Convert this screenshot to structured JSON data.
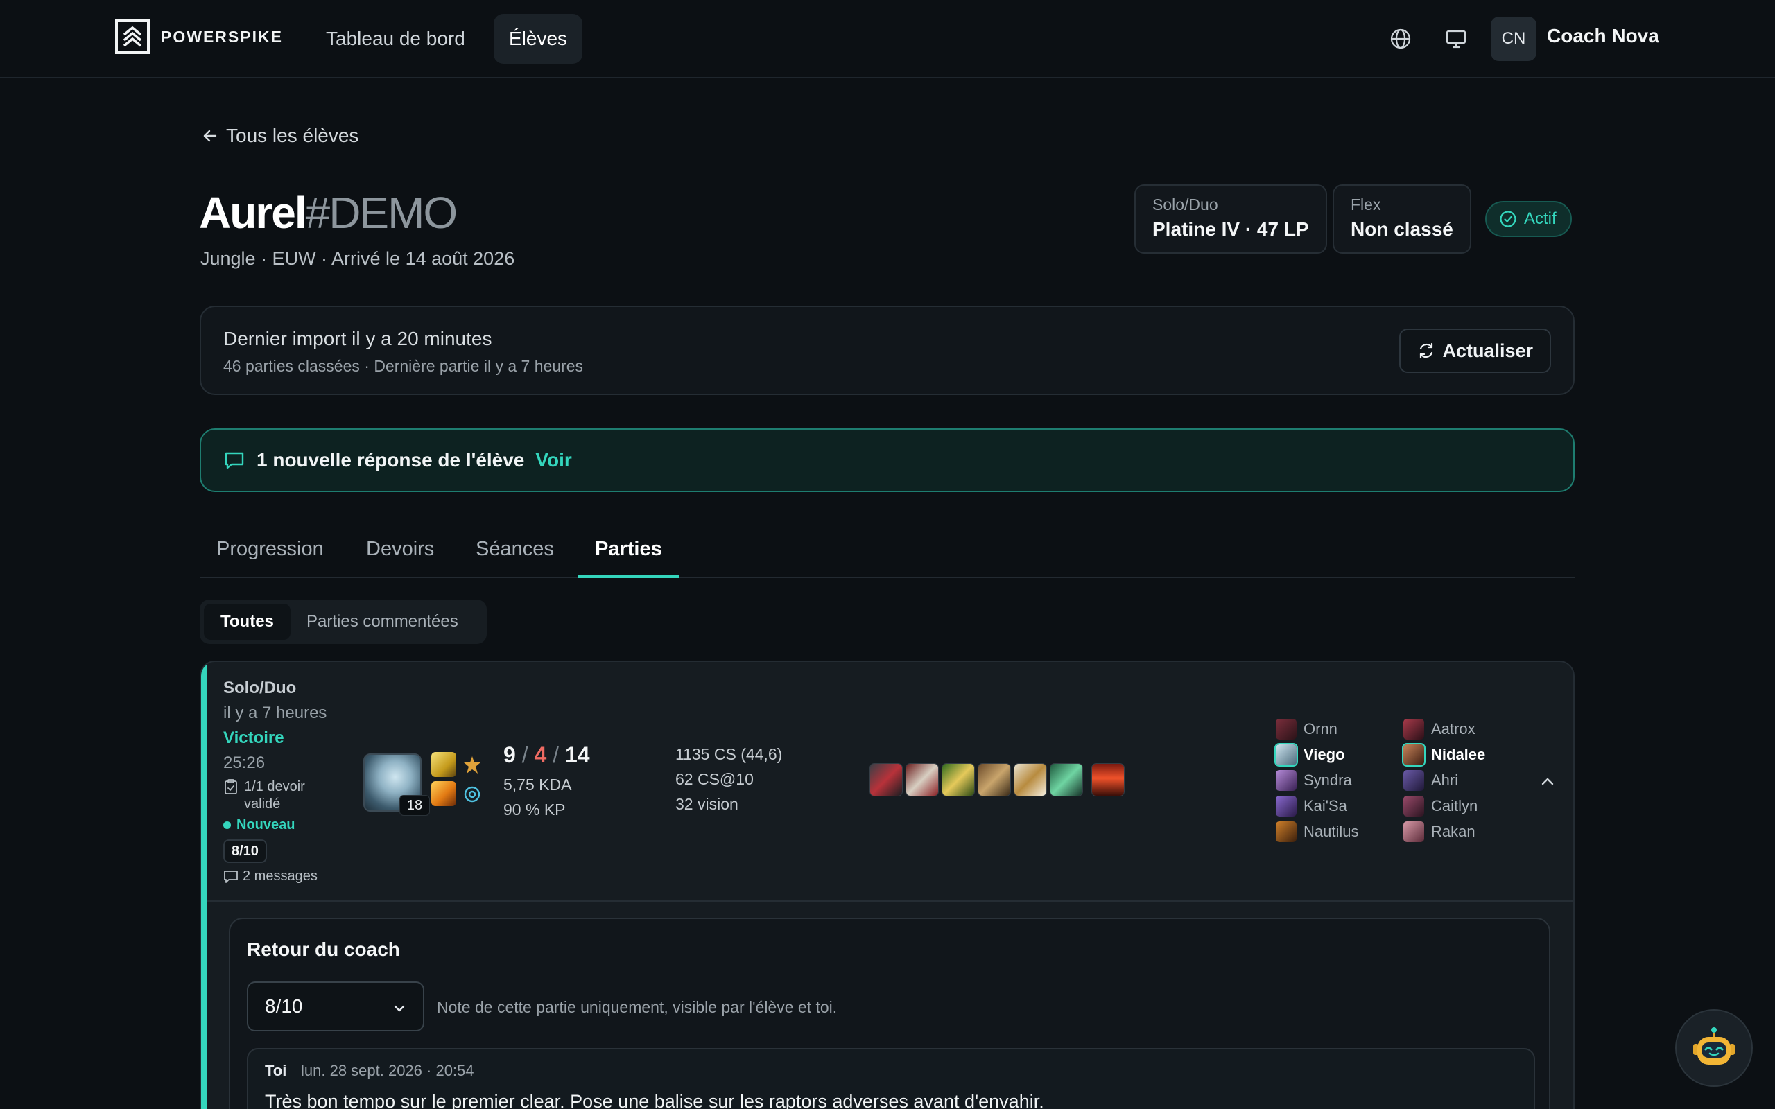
{
  "nav": {
    "brand": "POWERSPIKE",
    "links": [
      "Tableau de bord",
      "Élèves"
    ],
    "avatar_initials": "CN",
    "user_name": "Coach Nova"
  },
  "header": {
    "back_label": "Tous les élèves",
    "player_name": "Aurel",
    "player_tag": "#DEMO",
    "meta": "Jungle · EUW · Arrivé le 14 août 2026",
    "ranks": [
      {
        "queue": "Solo/Duo",
        "rank": "Platine IV · 47 LP"
      },
      {
        "queue": "Flex",
        "rank": "Non classé"
      }
    ],
    "status": "Actif"
  },
  "import": {
    "title": "Dernier import il y a 20 minutes",
    "subtitle": "46 parties classées · Dernière partie il y a 7 heures",
    "refresh_label": "Actualiser"
  },
  "notice": {
    "message": "1 nouvelle réponse de l'élève",
    "link": "Voir"
  },
  "tabs": [
    "Progression",
    "Devoirs",
    "Séances",
    "Parties"
  ],
  "active_tab": "Parties",
  "filters": [
    "Toutes",
    "Parties commentées"
  ],
  "match": {
    "queue": "Solo/Duo",
    "ago": "il y a 7 heures",
    "result": "Victoire",
    "duration": "25:26",
    "homework": "1/1 devoir validé",
    "new_label": "Nouveau",
    "grade": "8/10",
    "messages": "2 messages",
    "champion_level": "18",
    "kills": "9",
    "deaths": "4",
    "assists": "14",
    "kda_ratio": "5,75 KDA",
    "kill_participation": "90 % KP",
    "cs": "1135 CS (44,6)",
    "cs_at_10": "62 CS@10",
    "vision": "32 vision",
    "team_allies": [
      "Ornn",
      "Viego",
      "Syndra",
      "Kai'Sa",
      "Nautilus"
    ],
    "team_enemies": [
      "Aatrox",
      "Nidalee",
      "Ahri",
      "Caitlyn",
      "Rakan"
    ]
  },
  "feedback": {
    "title": "Retour du coach",
    "grade_value": "8/10",
    "grade_note": "Note de cette partie uniquement, visible par l'élève et toi.",
    "comment_author": "Toi",
    "comment_date": "lun. 28 sept. 2026 · 20:54",
    "comment_text": "Très bon tempo sur le premier clear. Pose une balise sur les raptors adverses avant d'envahir."
  },
  "colors": {
    "accent": "#34d6bd",
    "deaths": "#ef6b63",
    "background": "#0c1014"
  }
}
